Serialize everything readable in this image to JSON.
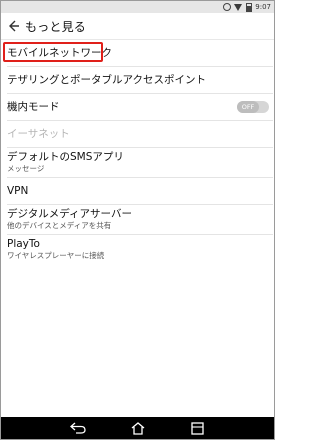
{
  "status_bar": {
    "time": "9:07",
    "icons": [
      "mute-icon",
      "wifi-icon",
      "battery-icon"
    ]
  },
  "app_bar": {
    "back_icon": "back-arrow-icon",
    "title": "もっと見る"
  },
  "items": [
    {
      "id": "mobile-network",
      "title": "モバイルネットワーク",
      "highlighted": true
    },
    {
      "id": "tethering",
      "title": "テザリングとポータブルアクセスポイント"
    },
    {
      "id": "airplane-mode",
      "title": "機内モード",
      "toggle_label": "OFF",
      "toggle_state": "off"
    },
    {
      "id": "ethernet",
      "title": "イーサネット",
      "disabled": true
    },
    {
      "id": "default-sms",
      "title": "デフォルトのSMSアプリ",
      "subtitle": "メッセージ"
    },
    {
      "id": "vpn",
      "title": "VPN"
    },
    {
      "id": "media-server",
      "title": "デジタルメディアサーバー",
      "subtitle": "他のデバイスとメディアを共有"
    },
    {
      "id": "playto",
      "title": "PlayTo",
      "subtitle": "ワイヤレスプレーヤーに接続"
    }
  ],
  "nav_bar": {
    "buttons": [
      "back-icon",
      "home-icon",
      "recent-apps-icon"
    ]
  },
  "colors": {
    "highlight": "#e0201a",
    "disabled_text": "#b5b5b5",
    "toggle_off": "#bdbdbd"
  }
}
